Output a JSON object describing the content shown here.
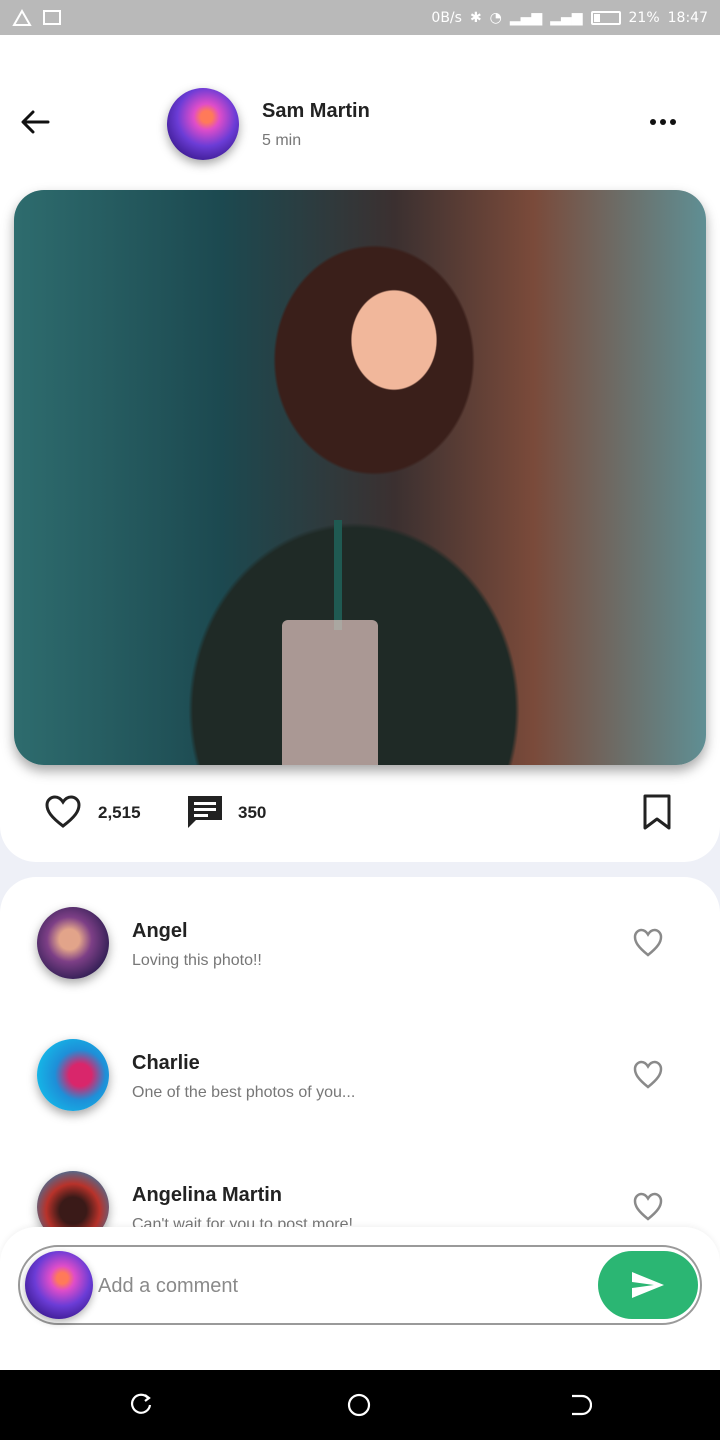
{
  "status_bar": {
    "net_speed": "0B/s",
    "battery": "21%",
    "time": "18:47"
  },
  "post": {
    "author": "Sam Martin",
    "time": "5 min",
    "likes": "2,515",
    "comments": "350"
  },
  "comments": [
    {
      "name": "Angel",
      "text": "Loving this photo!!"
    },
    {
      "name": "Charlie",
      "text": "One of the best photos of you..."
    },
    {
      "name": "Angelina Martin",
      "text": "Can't wait for you to post more!"
    }
  ],
  "composer": {
    "placeholder": "Add a comment"
  },
  "colors": {
    "send_button": "#2bb673",
    "page_background": "#eef0f7"
  },
  "icons": [
    "back-arrow-icon",
    "more-icon",
    "heart-icon",
    "comment-icon",
    "bookmark-icon",
    "send-icon"
  ]
}
